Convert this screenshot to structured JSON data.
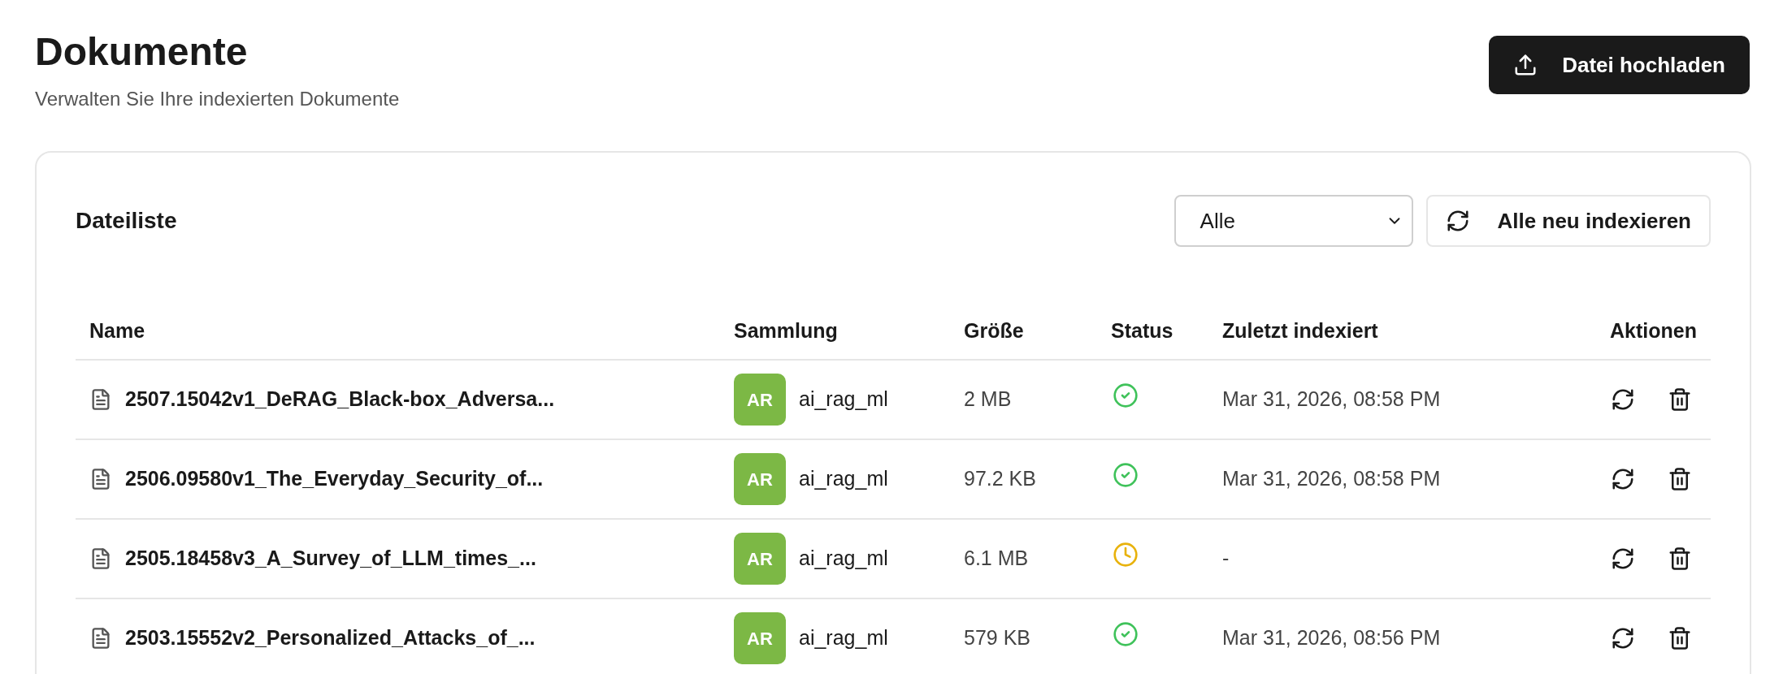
{
  "header": {
    "title": "Dokumente",
    "subtitle": "Verwalten Sie Ihre indexierten Dokumente",
    "upload_button": "Datei hochladen"
  },
  "card": {
    "title": "Dateiliste",
    "filter": {
      "value": "Alle"
    },
    "reindex_button": "Alle neu indexieren"
  },
  "table": {
    "columns": [
      "Name",
      "Sammlung",
      "Größe",
      "Status",
      "Zuletzt indexiert",
      "Aktionen"
    ],
    "rows": [
      {
        "name": "2507.15042v1_DeRAG_Black-box_Adversa...",
        "collection_badge": "AR",
        "collection": "ai_rag_ml",
        "size": "2 MB",
        "status": {
          "kind": "done"
        },
        "indexed": "Mar 31, 2026, 08:58 PM"
      },
      {
        "name": "2506.09580v1_The_Everyday_Security_of...",
        "collection_badge": "AR",
        "collection": "ai_rag_ml",
        "size": "97.2 KB",
        "status": {
          "kind": "done"
        },
        "indexed": "Mar 31, 2026, 08:58 PM"
      },
      {
        "name": "2505.18458v3_A_Survey_of_LLM_times_...",
        "collection_badge": "AR",
        "collection": "ai_rag_ml",
        "size": "6.1 MB",
        "status": {
          "kind": "pending"
        },
        "indexed": "-"
      },
      {
        "name": "2503.15552v2_Personalized_Attacks_of_...",
        "collection_badge": "AR",
        "collection": "ai_rag_ml",
        "size": "579 KB",
        "status": {
          "kind": "done"
        },
        "indexed": "Mar 31, 2026, 08:56 PM"
      }
    ]
  }
}
